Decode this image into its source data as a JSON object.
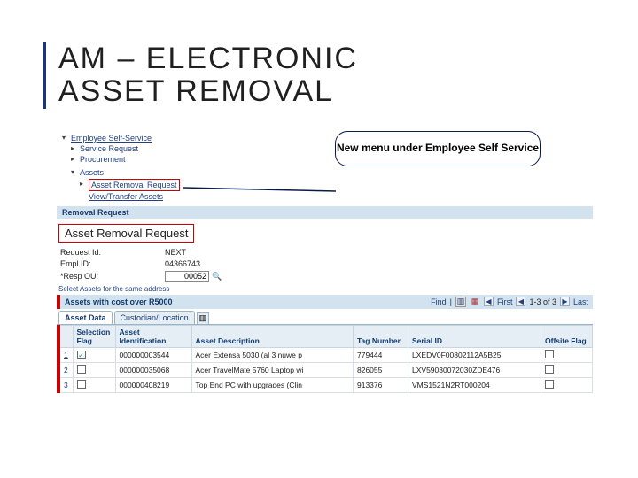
{
  "slide": {
    "title": "AM – ELECTRONIC\nASSET REMOVAL",
    "callout": "New menu under Employee Self Service"
  },
  "nav": {
    "root": "Employee Self-Service",
    "items": [
      "Service Request",
      "Procurement"
    ],
    "assets_label": "Assets",
    "asset_removal": "Asset Removal Request",
    "view_transfer": "View/Transfer Assets"
  },
  "section_bar": "Removal Request",
  "page_heading": "Asset Removal Request",
  "form": {
    "request_label": "Request Id:",
    "request_val": "NEXT",
    "empl_label": "Empl ID:",
    "empl_val": "04366743",
    "resp_label": "Resp OU:",
    "resp_val": "00052"
  },
  "hint": "Select Assets for the same address",
  "grid_header": {
    "title": "Assets with cost over R5000",
    "find": "Find",
    "first": "First",
    "range": "1-3 of 3",
    "last": "Last"
  },
  "tabs": {
    "data": "Asset Data",
    "cust": "Custodian/Location"
  },
  "columns": {
    "c0": "",
    "c1": "Selection Flag",
    "c2": "Asset Identification",
    "c3": "Asset Description",
    "c4": "Tag Number",
    "c5": "Serial ID",
    "c6": "Offsite Flag"
  },
  "rows": [
    {
      "n": "1",
      "sel": true,
      "asset_id": "000000003544",
      "desc": "Acer Extensa 5030 (al 3 nuwe p",
      "tag": "779444",
      "serial": "LXEDV0F00802112A5B25"
    },
    {
      "n": "2",
      "sel": false,
      "asset_id": "000000035068",
      "desc": "Acer TravelMate 5760 Laptop wi",
      "tag": "826055",
      "serial": "LXV59030072030ZDE476"
    },
    {
      "n": "3",
      "sel": false,
      "asset_id": "000000408219",
      "desc": "Top End PC with upgrades (Clin",
      "tag": "913376",
      "serial": "VMS1521N2RT000204"
    }
  ]
}
